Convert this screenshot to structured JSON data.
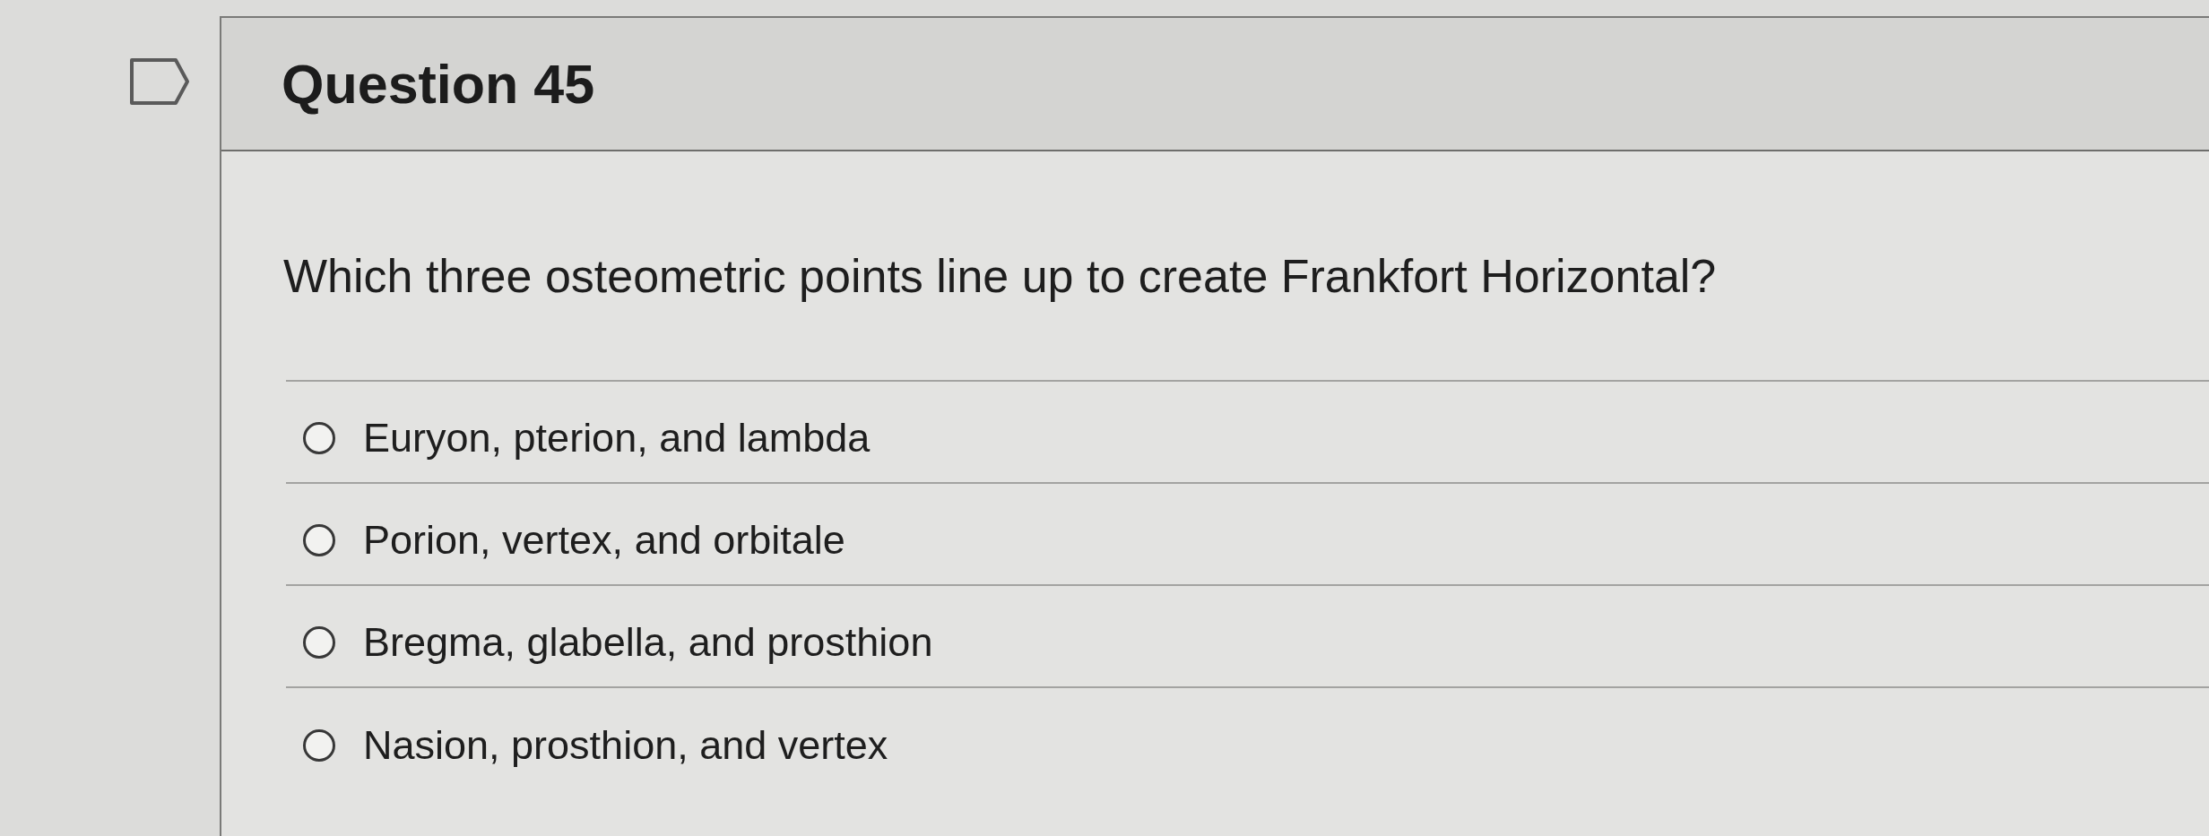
{
  "question": {
    "title": "Question 45",
    "flagged": false,
    "text": "Which three osteometric points line up to create Frankfort Horizontal?",
    "answers": [
      {
        "label": "Euryon, pterion, and lambda",
        "selected": false
      },
      {
        "label": "Porion, vertex, and orbitale",
        "selected": false
      },
      {
        "label": "Bregma, glabella, and prosthion",
        "selected": false
      },
      {
        "label": "Nasion, prosthion, and vertex",
        "selected": false
      }
    ]
  }
}
